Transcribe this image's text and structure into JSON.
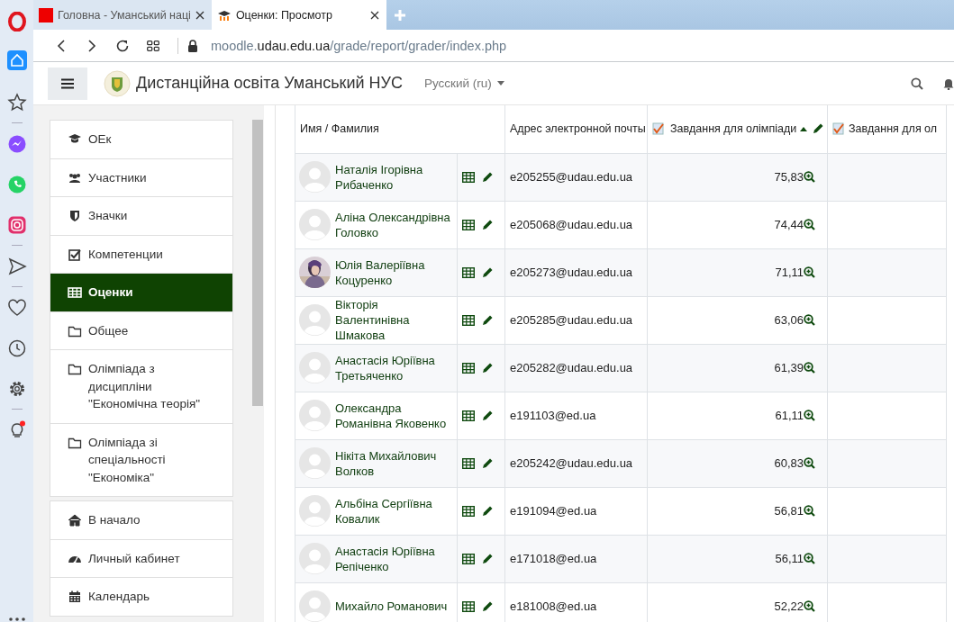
{
  "browser": {
    "tabs": [
      {
        "title": "Головна - Уманський наці",
        "kind": "nus",
        "selected": false
      },
      {
        "title": "Оценки: Просмотр",
        "kind": "moodle",
        "selected": true
      }
    ],
    "url_parts": [
      {
        "text": "moodle.",
        "emphasis": false
      },
      {
        "text": "udau.edu.ua",
        "emphasis": true
      },
      {
        "text": "/grade/report/grader/index.php",
        "emphasis": false
      }
    ]
  },
  "site": {
    "name": "Дистанційна освіта Уманський НУС",
    "language": "Русский (ru)"
  },
  "nav": {
    "sections": [
      {
        "items": [
          {
            "label": "ОЕк",
            "kind": "course",
            "selected": false
          },
          {
            "label": "Участники",
            "kind": "users",
            "selected": false
          },
          {
            "label": "Значки",
            "kind": "shield",
            "selected": false
          },
          {
            "label": "Компетенции",
            "kind": "check",
            "selected": false
          },
          {
            "label": "Оценки",
            "kind": "table",
            "selected": true
          },
          {
            "label": "Общее",
            "kind": "folder",
            "selected": false
          },
          {
            "label": "Олімпіада з дисципліни \"Економічна теорія\"",
            "kind": "folder",
            "selected": false
          },
          {
            "label": "Олімпіада зі спеціальності \"Економіка\"",
            "kind": "folder",
            "selected": false
          }
        ]
      },
      {
        "items": [
          {
            "label": "В начало",
            "kind": "home",
            "selected": false
          },
          {
            "label": "Личный кабинет",
            "kind": "dashboard",
            "selected": false
          },
          {
            "label": "Календарь",
            "kind": "calendar",
            "selected": false
          }
        ]
      }
    ]
  },
  "table": {
    "columns": [
      {
        "label": "Имя / Фамилия",
        "kind": "name",
        "sorted": false
      },
      {
        "label": "Адрес электронной почты",
        "kind": "email",
        "sorted": false
      },
      {
        "label": "Завдання для олімпіади",
        "kind": "grade",
        "sorted": true
      },
      {
        "label": "Завдання для ол",
        "kind": "grade",
        "sorted": false
      }
    ],
    "rows": [
      {
        "name": "Наталія Ігорівна Рибаченко",
        "kind": "default",
        "email": "e205255@udau.edu.ua",
        "grade": "75,83"
      },
      {
        "name": "Аліна Олександрівна Головко",
        "kind": "default",
        "email": "e205068@udau.edu.ua",
        "grade": "74,44"
      },
      {
        "name": "Юлія Валеріївна Коцуренко",
        "email": "e205273@udau.edu.ua",
        "grade": "71,11"
      },
      {
        "name": "Вікторія Валентинівна Шмакова",
        "kind": "default",
        "email": "e205285@udau.edu.ua",
        "grade": "63,06"
      },
      {
        "name": "Анастасія Юріївна Третьяченко",
        "kind": "default",
        "email": "e205282@udau.edu.ua",
        "grade": "61,39"
      },
      {
        "name": "Олександра Романівна Яковенко",
        "kind": "default",
        "email": "e191103@ed.ua",
        "grade": "61,11"
      },
      {
        "name": "Нікіта Михайлович Волков",
        "kind": "default",
        "email": "e205242@udau.edu.ua",
        "grade": "60,83"
      },
      {
        "name": "Альбіна Сергіївна Ковалик",
        "kind": "default",
        "email": "e191094@ed.ua",
        "grade": "56,81"
      },
      {
        "name": "Анастасія Юріївна Репіченко",
        "kind": "default",
        "email": "e171018@ed.ua",
        "grade": "56,11"
      },
      {
        "name": "Михайло Романович",
        "kind": "default",
        "email": "e181008@ed.ua",
        "grade": "52,22"
      }
    ]
  }
}
